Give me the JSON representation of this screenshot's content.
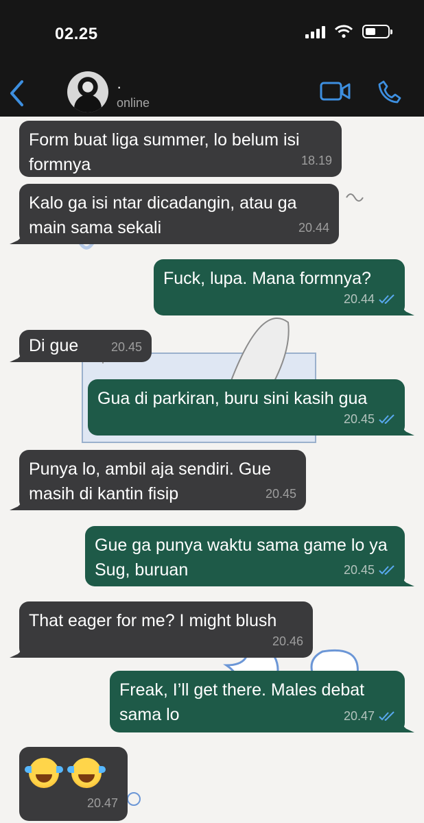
{
  "status_bar": {
    "time": "02.25"
  },
  "header": {
    "contact_name": "·",
    "contact_status": "online"
  },
  "messages": [
    {
      "text": "Form buat liga summer, lo belum isi formnya",
      "time": "18.19",
      "direction": "in"
    },
    {
      "text": "Kalo ga isi ntar dicadangin, atau ga main sama sekali",
      "time": "20.44",
      "direction": "in"
    },
    {
      "text": "Fuck, lupa. Mana formnya?",
      "time": "20.44",
      "direction": "out",
      "read": true
    },
    {
      "text": "Di gue",
      "time": "20.45",
      "direction": "in"
    },
    {
      "text": "Gua di parkiran, buru sini kasih gua",
      "time": "20.45",
      "direction": "out",
      "read": true
    },
    {
      "text": "Punya lo, ambil aja sendiri. Gue masih di kantin fisip",
      "time": "20.45",
      "direction": "in"
    },
    {
      "text": "Gue ga punya waktu sama game lo ya Sug, buruan",
      "time": "20.45",
      "direction": "out",
      "read": true
    },
    {
      "text": "That eager for me? I might blush",
      "time": "20.46",
      "direction": "in"
    },
    {
      "text": "Freak, I’ll get there. Males debat sama lo",
      "time": "20.47",
      "direction": "out",
      "read": true
    },
    {
      "emojis": [
        "face-with-tears-of-joy",
        "face-with-tears-of-joy"
      ],
      "time": "20.47",
      "direction": "in"
    }
  ],
  "colors": {
    "header_bg": "#161616",
    "incoming_bubble": "#3a3a3c",
    "outgoing_bubble": "#1e5a48",
    "accent": "#3d8fe0",
    "read_ticks": "#59a9f0"
  },
  "icons": [
    "back-chevron-icon",
    "video-call-icon",
    "phone-icon",
    "signal-icon",
    "wifi-icon",
    "battery-icon",
    "double-check-icon"
  ]
}
